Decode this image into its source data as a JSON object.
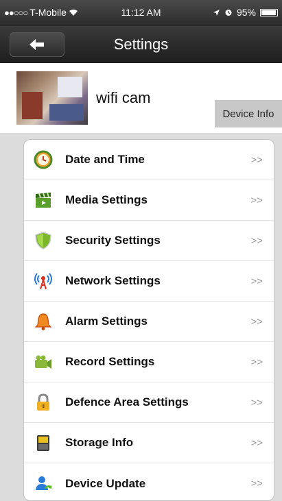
{
  "status_bar": {
    "carrier": "T-Mobile",
    "time": "11:12 AM",
    "battery": "95%"
  },
  "nav": {
    "title": "Settings"
  },
  "device": {
    "name": "wifi cam",
    "info_button": "Device Info"
  },
  "chevron": ">>",
  "settings_items": [
    {
      "label": "Date and Time",
      "icon": "clock-icon"
    },
    {
      "label": "Media Settings",
      "icon": "clapperboard-icon"
    },
    {
      "label": "Security Settings",
      "icon": "shield-icon"
    },
    {
      "label": "Network Settings",
      "icon": "antenna-icon"
    },
    {
      "label": "Alarm Settings",
      "icon": "bell-icon"
    },
    {
      "label": "Record Settings",
      "icon": "camcorder-icon"
    },
    {
      "label": "Defence Area Settings",
      "icon": "lock-icon"
    },
    {
      "label": "Storage Info",
      "icon": "sd-card-icon"
    },
    {
      "label": "Device Update",
      "icon": "user-update-icon"
    }
  ],
  "colors": {
    "nav_bg": "#2b2b2b",
    "list_bg": "#dcdcdc",
    "device_info_bg": "#c8c8c8"
  }
}
